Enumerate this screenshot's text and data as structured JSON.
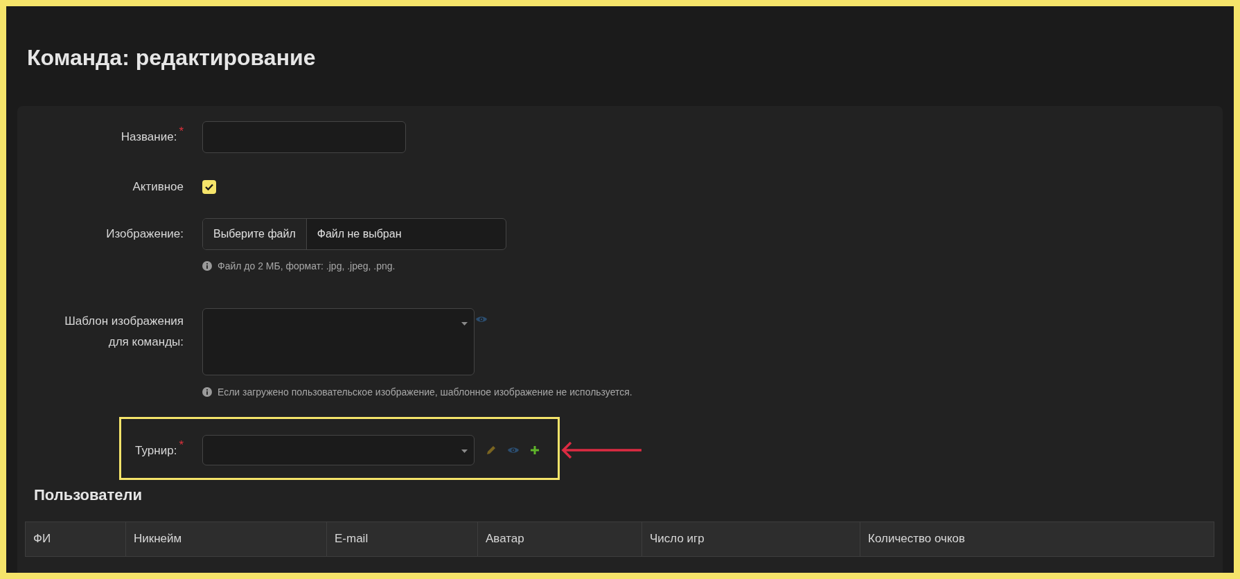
{
  "page": {
    "title": "Команда: редактирование"
  },
  "form": {
    "name": {
      "label": "Название:",
      "required_mark": "*"
    },
    "active": {
      "label": "Активное",
      "checked": true
    },
    "image": {
      "label": "Изображение:",
      "button": "Выберите файл",
      "file_status": "Файл не выбран",
      "hint": "Файл до 2 МБ, формат: .jpg, .jpeg, .png."
    },
    "template": {
      "label_lines": [
        "Шаблон изображения",
        "для команды:"
      ],
      "hint": "Если загружено пользовательское изображение, шаблонное изображение не используется."
    },
    "tournament": {
      "label": "Турнир:",
      "required_mark": "*"
    }
  },
  "users": {
    "title": "Пользователи",
    "columns": [
      "ФИ",
      "Никнейм",
      "E-mail",
      "Аватар",
      "Число игр",
      "Количество очков"
    ]
  }
}
